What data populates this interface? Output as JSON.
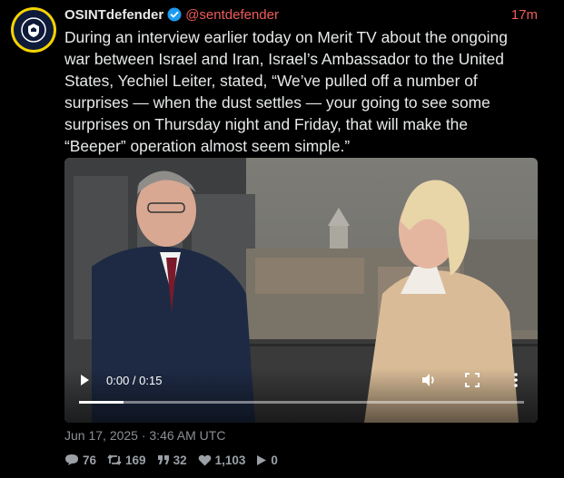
{
  "account": {
    "name": "OSINTdefender",
    "handle": "@sentdefender",
    "time_ago": "17m"
  },
  "tweet": {
    "text": "During an interview earlier today on Merit TV about the ongoing\nwar between Israel and Iran, Israel’s Ambassador to the United\nStates, Yechiel Leiter, stated, “We’ve pulled off a number of\nsurprises — when the dust settles — your going to see some\nsurprises on Thursday night and Friday, that will make the\n“Beeper” operation almost seem simple.”",
    "posted_at": "Jun 17, 2025 · 3:46 AM UTC"
  },
  "video": {
    "time_display": "0:00 / 0:15",
    "progress_fraction": 0.1
  },
  "stats": {
    "replies": "76",
    "retweets": "169",
    "quotes": "32",
    "likes": "1,103",
    "views": "0"
  },
  "colors": {
    "accent": "#f05a5a",
    "verified": "#1d9bf0",
    "avatar_ring": "#f5d400"
  }
}
